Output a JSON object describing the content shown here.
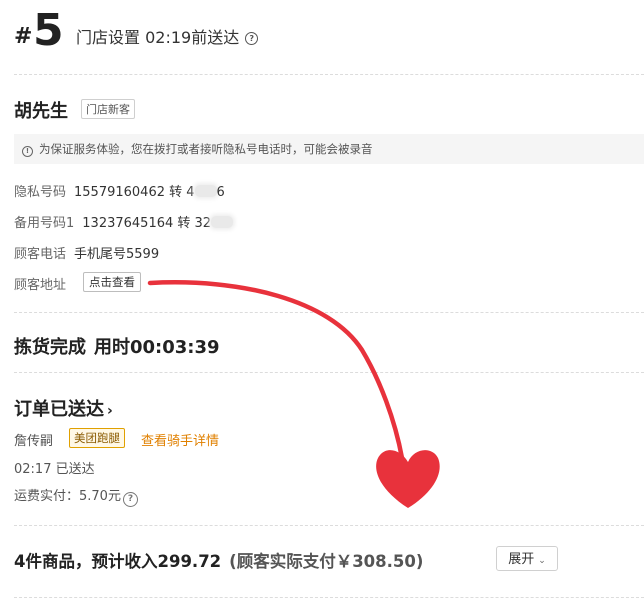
{
  "header": {
    "hash": "#",
    "order_number": "5",
    "delivery_info": "门店设置 02:19前送达",
    "help_glyph": "?"
  },
  "customer": {
    "name": "胡先生",
    "tag": "门店新客",
    "notice_glyph": "!",
    "notice": "为保证服务体验，您在拨打或者接听隐私号电话时，可能会被录音",
    "privacy_label": "隐私号码",
    "privacy_value": "15579160462 转 4",
    "privacy_suffix": "6",
    "backup_label": "备用号码1",
    "backup_value": "13237645164 转 32",
    "phone_label": "顾客电话",
    "phone_value": "手机尾号5599",
    "address_label": "顾客地址",
    "address_button": "点击查看"
  },
  "picking": {
    "status": "拣货完成",
    "duration": "用时00:03:39"
  },
  "delivery": {
    "status": "订单已送达",
    "chevron": "›",
    "rider_name": "詹传嗣",
    "rider_tag": "美团跑腿",
    "rider_link": "查看骑手详情",
    "delivered_time": "02:17 已送达",
    "fee_label": "运费实付：5.70元",
    "fee_glyph": "?"
  },
  "summary": {
    "items_income": "4件商品，预计收入299.72",
    "customer_paid": "(顾客实际支付￥308.50)",
    "expand_label": "展开",
    "expand_chevron": "⌄"
  },
  "colors": {
    "annotation_red": "#e8323c",
    "link_orange": "#e08000",
    "tag_border": "#e0a000"
  }
}
